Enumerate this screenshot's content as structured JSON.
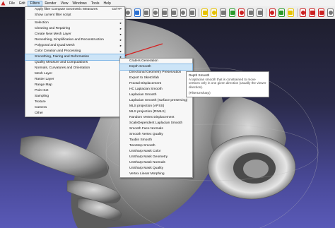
{
  "menubar": {
    "items": [
      "File",
      "Edit",
      "Filters",
      "Render",
      "View",
      "Windows",
      "Tools",
      "Help"
    ],
    "active_index": 2
  },
  "filters_menu": {
    "items": [
      {
        "label": "Apply filter Compute Geometric Measures",
        "shortcut": "Ctrl+P"
      },
      {
        "label": "Show current filter script",
        "shortcut": ""
      },
      {
        "separator": true
      },
      {
        "label": "Selection",
        "submenu": true
      },
      {
        "label": "Cleaning and Repairing",
        "submenu": true
      },
      {
        "label": "Create New Mesh Layer",
        "submenu": true
      },
      {
        "label": "Remeshing, Simplification and Reconstruction",
        "submenu": true
      },
      {
        "label": "Polygonal and Quad Mesh",
        "submenu": true
      },
      {
        "label": "Color Creation and Processing",
        "submenu": true
      },
      {
        "label": "Smoothing, Fairing and Deformation",
        "submenu": true,
        "highlighted": true
      },
      {
        "label": "Quality Measure and Computations",
        "submenu": true
      },
      {
        "label": "Normals, Curvatures and Orientation",
        "submenu": true
      },
      {
        "label": "Mesh Layer",
        "submenu": true
      },
      {
        "label": "Raster Layer",
        "submenu": true
      },
      {
        "label": "Range Map",
        "submenu": true
      },
      {
        "label": "Point Set",
        "submenu": true
      },
      {
        "label": "Sampling",
        "submenu": true
      },
      {
        "label": "Texture",
        "submenu": true
      },
      {
        "label": "Camera",
        "submenu": true
      },
      {
        "label": "Other",
        "submenu": true
      }
    ]
  },
  "smoothing_submenu": {
    "items": [
      {
        "label": "Craters Generation"
      },
      {
        "label": "Depth Smooth",
        "highlighted": true
      },
      {
        "label": "Directional Geometry Preservation"
      },
      {
        "label": "Export to Sketchfab"
      },
      {
        "label": "Fractal Displacement"
      },
      {
        "label": "HC Laplacian Smooth"
      },
      {
        "label": "Laplacian Smooth"
      },
      {
        "label": "Laplacian Smooth (surface preserving)"
      },
      {
        "label": "MLS projection (APSS)"
      },
      {
        "label": "MLS projection (RIMLS)"
      },
      {
        "label": "Random Vertex Displacement"
      },
      {
        "label": "ScaleDependent Laplacian Smooth"
      },
      {
        "label": "Smooth Face Normals"
      },
      {
        "label": "Smooth Vertex Quality"
      },
      {
        "label": "Taubin Smooth"
      },
      {
        "label": "TwoStep Smooth"
      },
      {
        "label": "UnSharp Mask Color"
      },
      {
        "label": "UnSharp Mask Geometry"
      },
      {
        "label": "UnSharp Mask Normals"
      },
      {
        "label": "UnSharp Mask Quality"
      },
      {
        "label": "Vertex Linear Morphing"
      }
    ]
  },
  "tooltip": {
    "title": "Depth Smooth",
    "body": "A laplacian smooth that is constrained to move vertices only in one given direction (usually the viewer direction).",
    "filter": "(FilterUnsharp)"
  },
  "toolbar": {
    "icons": [
      "layers-icon",
      "vertex-icon",
      "points-icon",
      "wireframe-icon",
      "hidden-lines-icon",
      "flat-icon",
      "smooth-icon",
      "texture-icon",
      "select-icon",
      "light-icon",
      "fullscreen-icon",
      "align-icon",
      "paint-icon",
      "measure-icon",
      "pick-icon",
      "filter-icon",
      "shader-icon",
      "info-icon",
      "close-red-icon",
      "cut-icon",
      "delete-icon",
      "snapshot-icon"
    ],
    "colors": {
      "red": "#cc2222",
      "yellow": "#e6c200",
      "green": "#2a9a2a",
      "blue": "#2a6fd0",
      "gray": "#777777"
    }
  },
  "colors": {
    "menu_bg": "#f7f7f7",
    "highlight": "#cce4f7",
    "highlight_border": "#7fb6e6",
    "viewport_top": "#1c1c28",
    "viewport_bottom": "#5a5ab8",
    "arrow": "#d42020"
  }
}
